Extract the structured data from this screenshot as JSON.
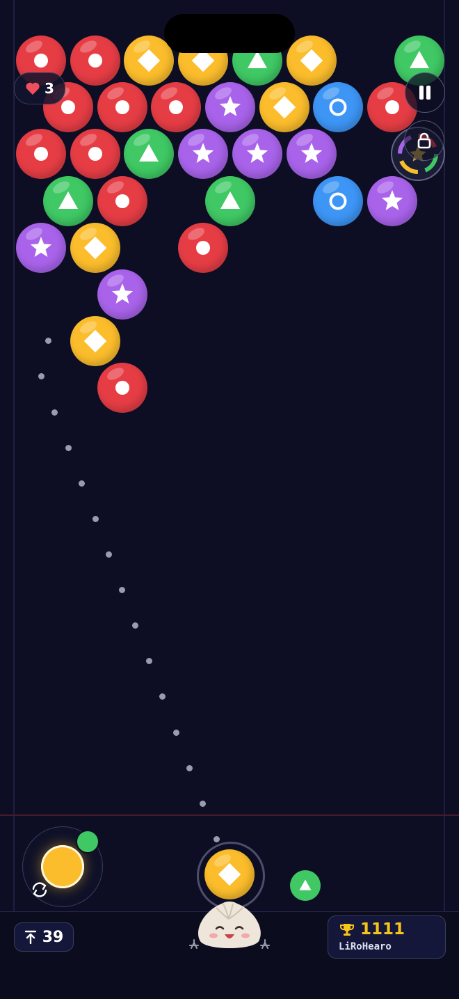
{
  "colors": {
    "red": "#e63d45",
    "yellow": "#fbbd2c",
    "green": "#3fc864",
    "purple": "#a863ea",
    "blue": "#3d95f5",
    "background": "#0d0e24",
    "score_gold": "#f5c518"
  },
  "hud": {
    "lives": "3",
    "moves_remaining": "39",
    "score": "1111",
    "player_name": "LiRoHearo"
  },
  "icons": {
    "lives": "heart-icon",
    "pause": "pause-icon",
    "powerup": "lock-icon",
    "moves": "arrow-up-bar-icon",
    "score": "trophy-icon",
    "swap": "swap-arrows-icon"
  },
  "grid": [
    [
      "red",
      "red",
      "yellow",
      "yellow",
      "green",
      "yellow",
      null,
      "green"
    ],
    [
      "red",
      "red",
      "red",
      "purple",
      "yellow",
      "blue",
      "red"
    ],
    [
      "red",
      "red",
      "green",
      "purple",
      "purple",
      "purple",
      null,
      null
    ],
    [
      "green",
      "red",
      null,
      "green",
      null,
      "blue",
      "purple"
    ],
    [
      "purple",
      "yellow",
      null,
      "red",
      null,
      null,
      null,
      null
    ],
    [
      null,
      "purple"
    ],
    [
      null,
      "yellow",
      null,
      null,
      null,
      null,
      null,
      null
    ],
    [
      null,
      "red"
    ]
  ],
  "launcher": {
    "current": "yellow",
    "next": "green",
    "swap_bubble": "yellow",
    "swap_badge": "green"
  },
  "mascot": "dumpling-mascot"
}
